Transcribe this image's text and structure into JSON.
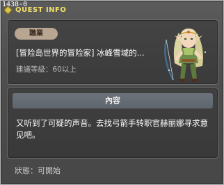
{
  "window": {
    "quest_id": "1438-0",
    "title": "QUEST INFO"
  },
  "quest": {
    "job_label": "職業",
    "title": "[冒险岛世界的冒险家] 冰峰雪域的...",
    "required_level": "建議等級：60以上"
  },
  "content": {
    "header": "內容",
    "body": "又听到了可疑的声音。去找弓箭手转职官赫丽娜寻求意见吧。"
  },
  "status": {
    "label": "狀態：",
    "value": "可開始"
  },
  "colors": {
    "title": "#f2e06a",
    "job_badge": "#b8a592",
    "content_header": "#6c737a"
  },
  "icons": {
    "npc": "npc-helena-archer-portrait",
    "title_bullet": "diamond-bullet-icon"
  }
}
